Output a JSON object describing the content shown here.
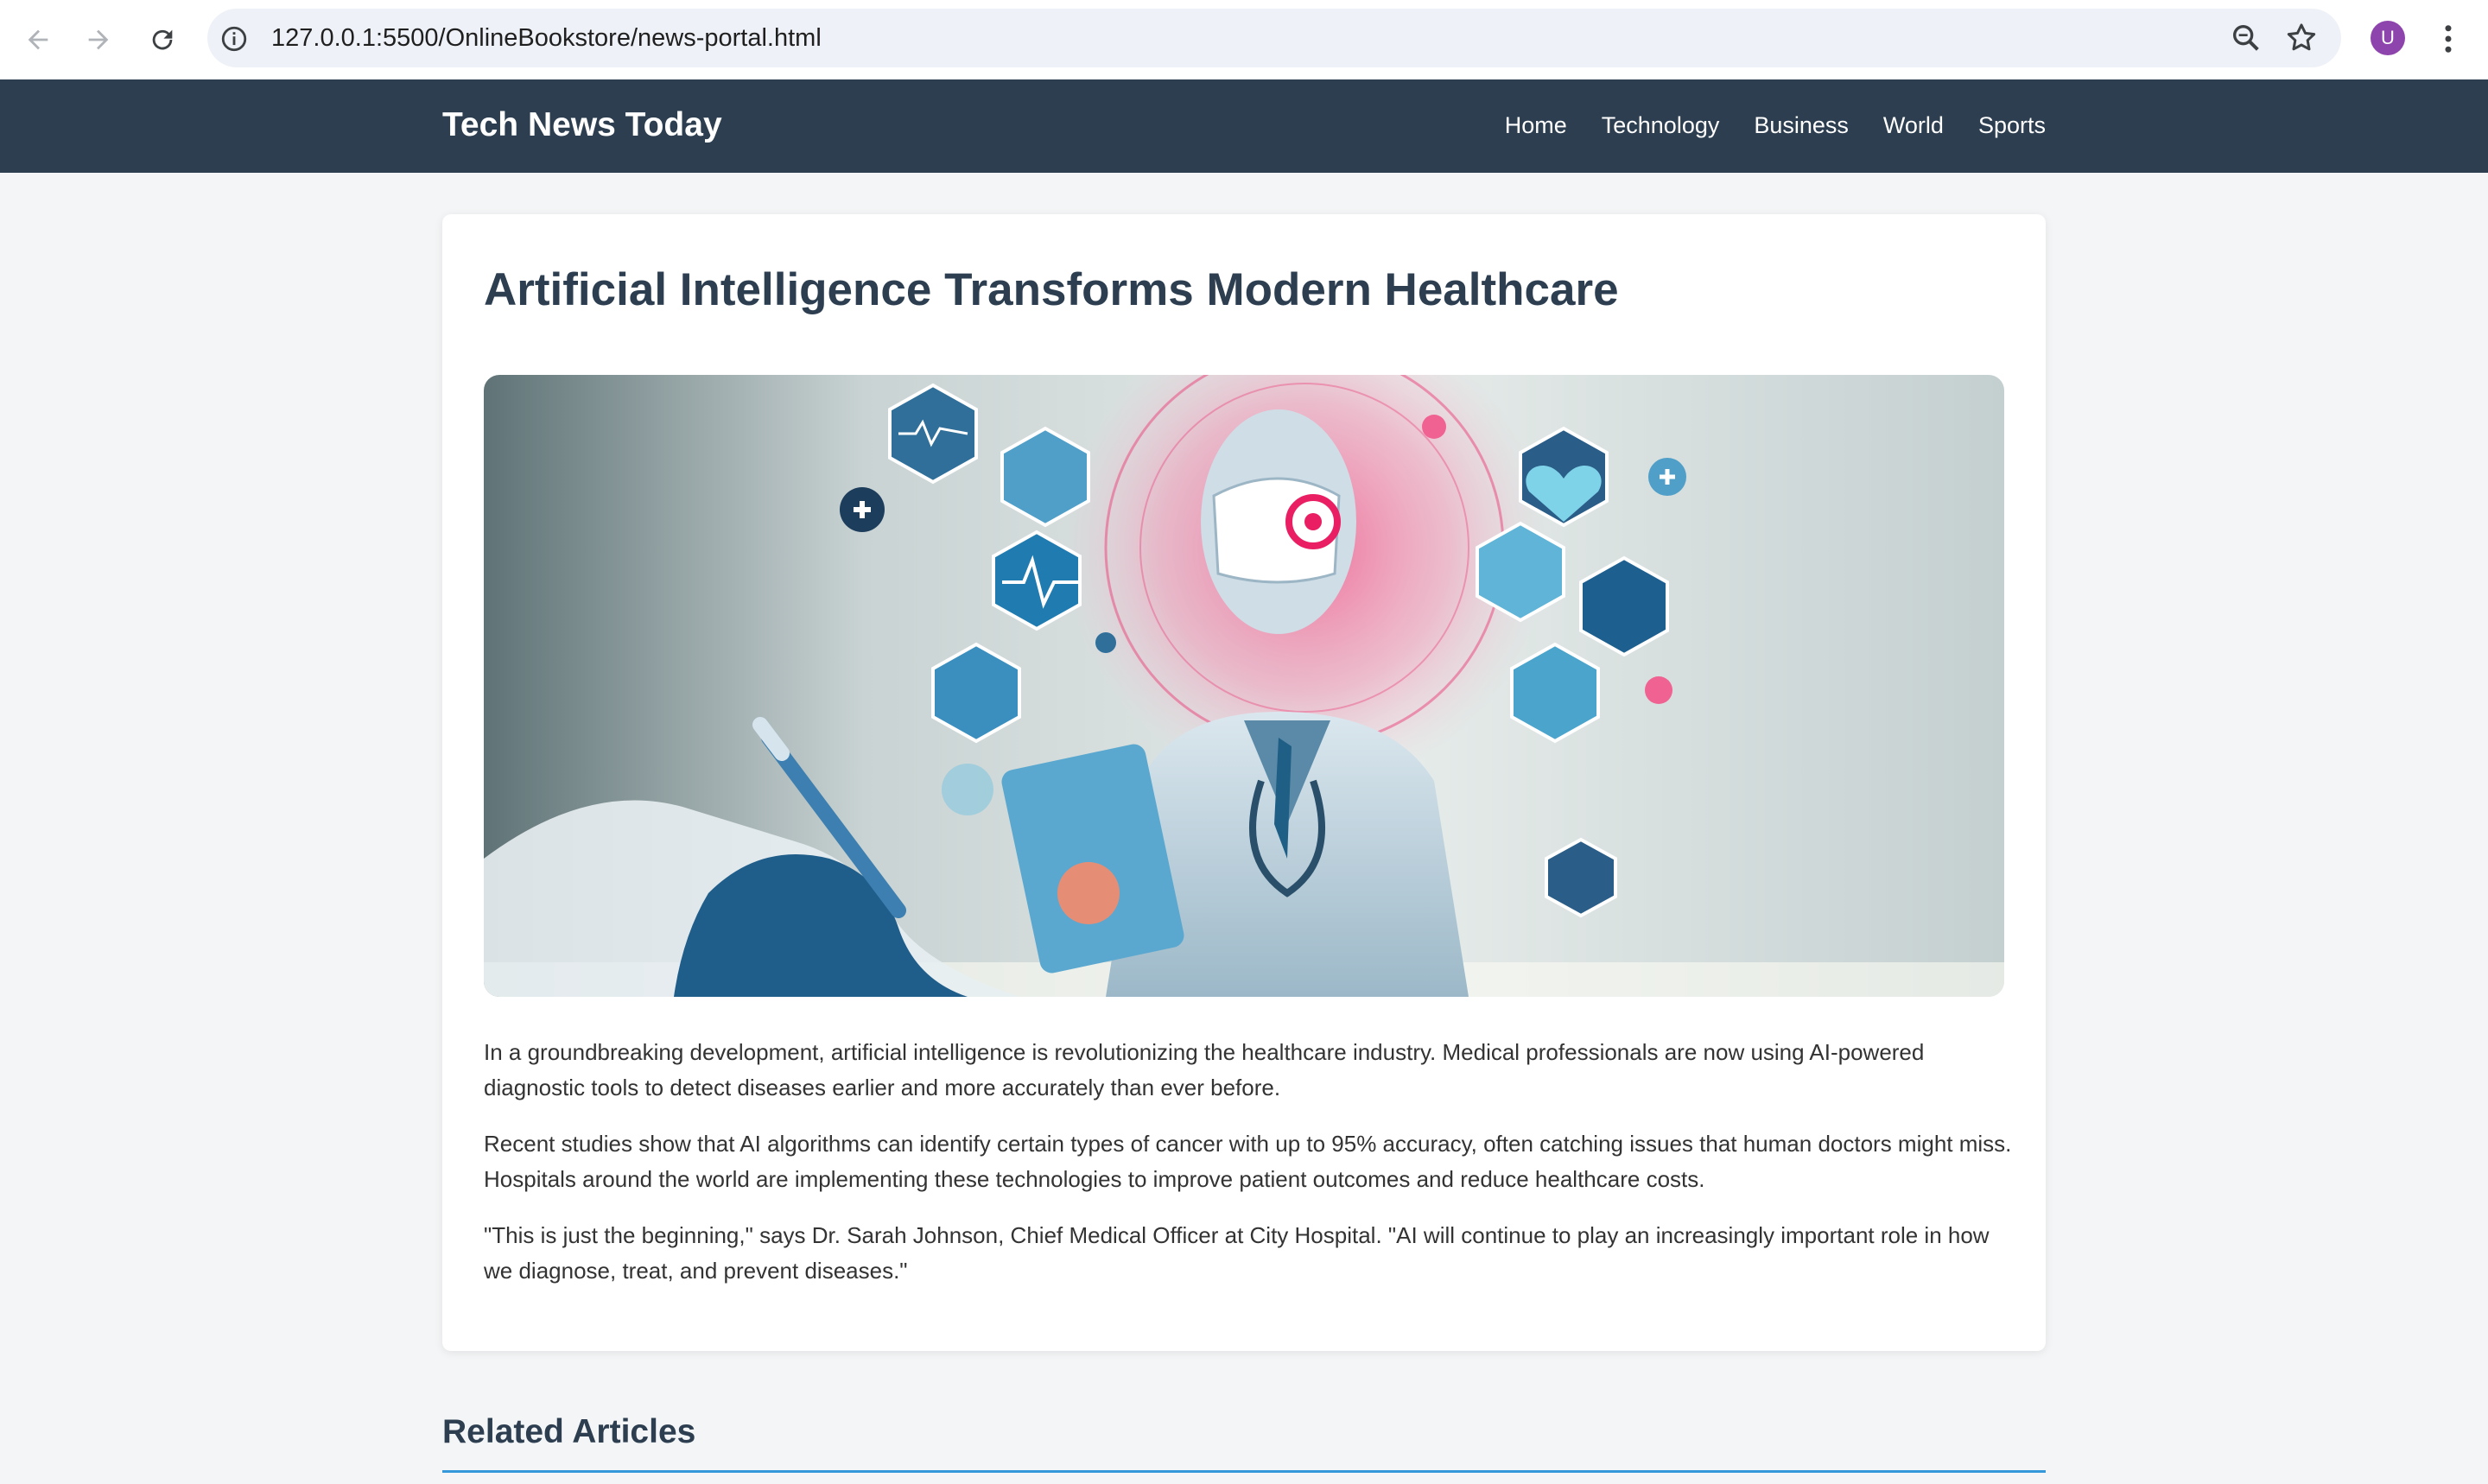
{
  "browser": {
    "url": "127.0.0.1:5500/OnlineBookstore/news-portal.html",
    "avatar_letter": "U",
    "icons": [
      "back-arrow-icon",
      "forward-arrow-icon",
      "reload-icon",
      "site-info-icon",
      "zoom-icon",
      "bookmark-star-icon",
      "kebab-menu-icon"
    ]
  },
  "header": {
    "logo": "Tech News Today",
    "nav": [
      {
        "label": "Home"
      },
      {
        "label": "Technology"
      },
      {
        "label": "Business"
      },
      {
        "label": "World"
      },
      {
        "label": "Sports"
      }
    ]
  },
  "article": {
    "title": "Artificial Intelligence Transforms Modern Healthcare",
    "paragraphs": [
      "In a groundbreaking development, artificial intelligence is revolutionizing the healthcare industry. Medical professionals are now using AI-powered diagnostic tools to detect diseases earlier and more accurately than ever before.",
      "Recent studies show that AI algorithms can identify certain types of cancer with up to 95% accuracy, often catching issues that human doctors might miss. Hospitals around the world are implementing these technologies to improve patient outcomes and reduce healthcare costs.",
      "\"This is just the beginning,\" says Dr. Sarah Johnson, Chief Medical Officer at City Hospital. \"AI will continue to play an increasingly important role in how we diagnose, treat, and prevent diseases.\""
    ]
  },
  "related": {
    "title": "Related Articles"
  },
  "colors": {
    "header_bg": "#2c3e50",
    "title_color": "#2c3e50",
    "accent": "#3498db",
    "page_bg": "#f4f5f6"
  }
}
